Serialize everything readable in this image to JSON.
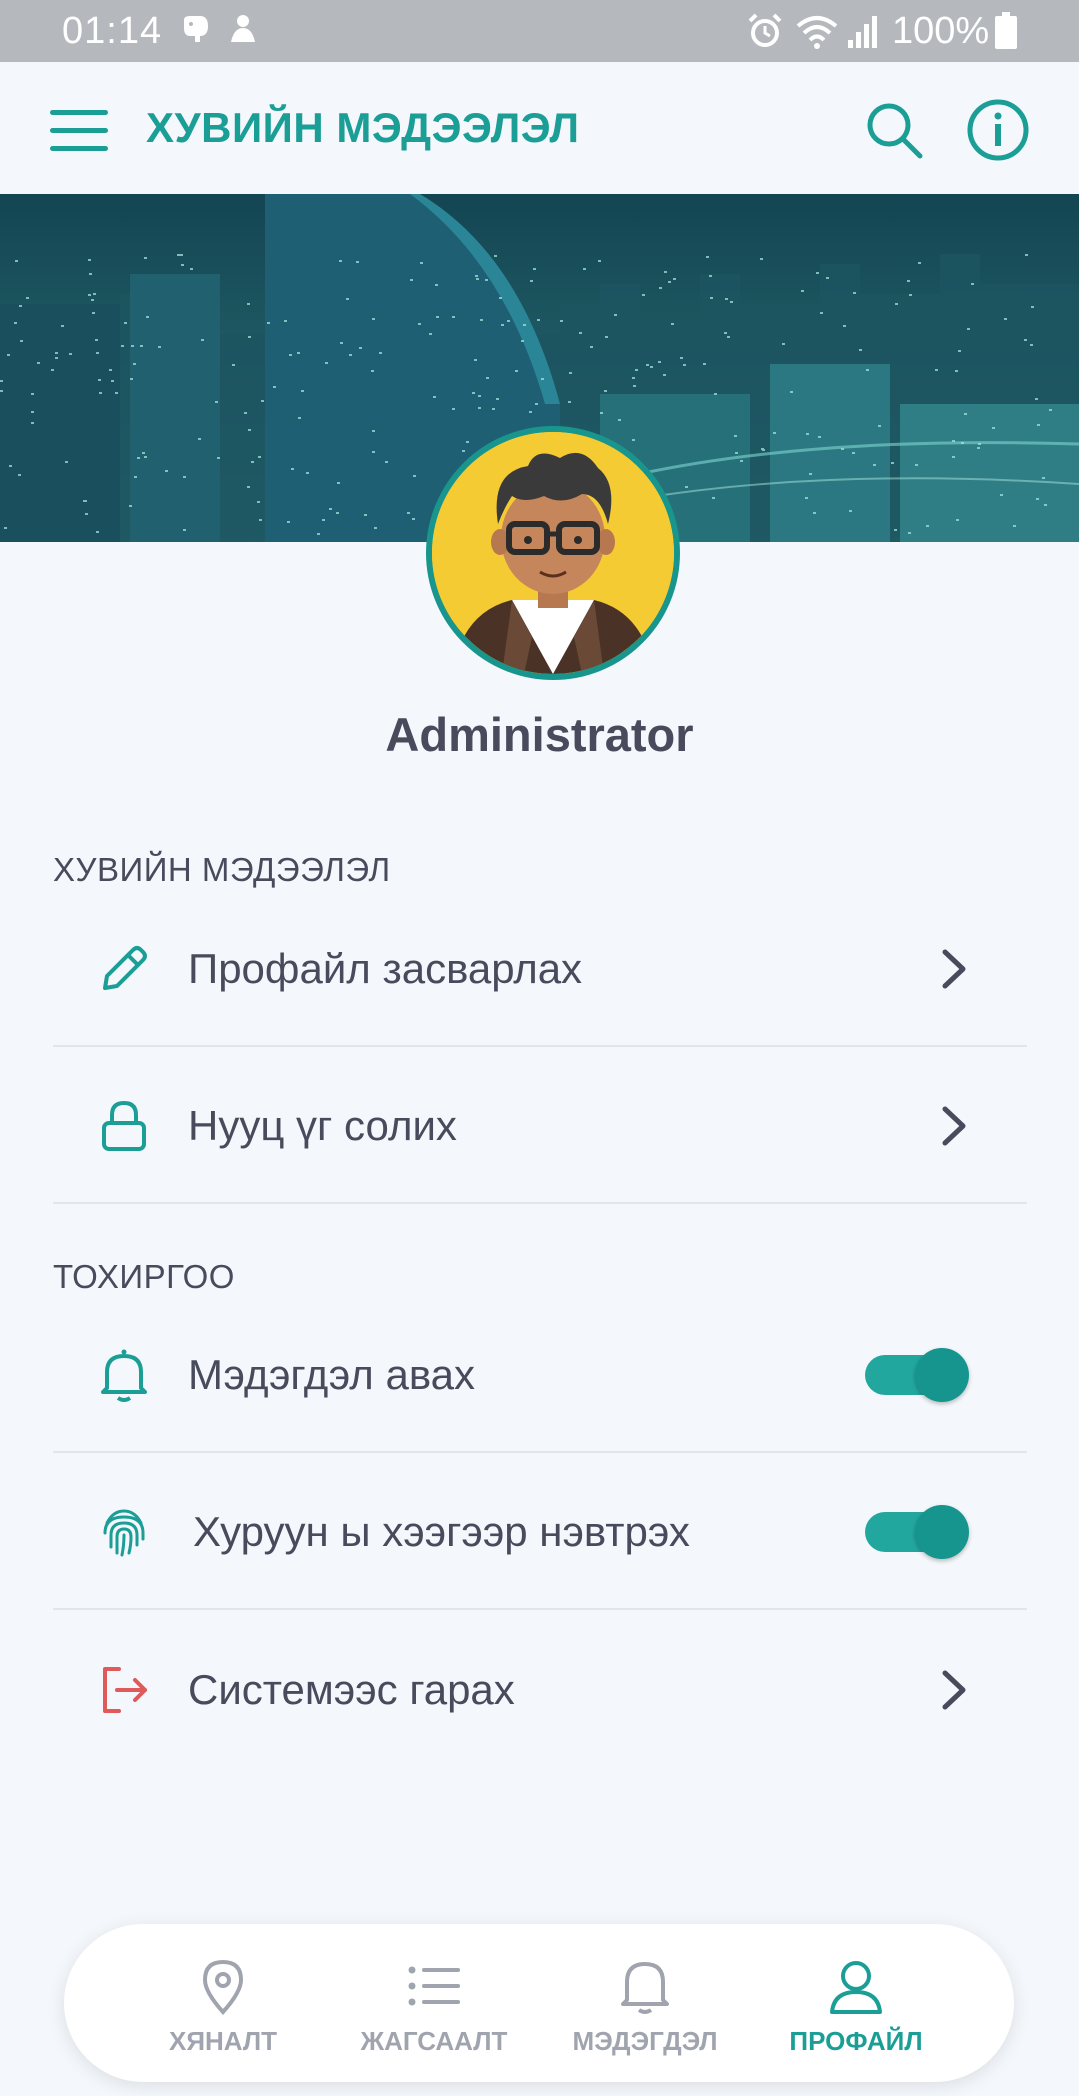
{
  "status_bar": {
    "time": "01:14",
    "battery": "100%",
    "icons": [
      "elephant-icon",
      "person-icon",
      "alarm-icon",
      "wifi-icon",
      "signal-icon",
      "battery-icon"
    ]
  },
  "app_bar": {
    "title": "ХУВИЙН МЭДЭЭЛЭЛ",
    "icons": [
      "menu-icon",
      "search-icon",
      "info-icon"
    ]
  },
  "profile": {
    "name": "Administrator"
  },
  "sections": {
    "personal": {
      "title": "ХУВИЙН МЭДЭЭЛЭЛ",
      "items": [
        {
          "label": "Профайл засварлах",
          "icon": "pencil-icon"
        },
        {
          "label": "Нууц үг солих",
          "icon": "lock-icon"
        }
      ]
    },
    "settings": {
      "title": "ТОХИРГОО",
      "items": [
        {
          "label": "Мэдэгдэл авах",
          "icon": "bell-icon",
          "toggle_on": true
        },
        {
          "label": "Хуруун ы хээгээр нэвтрэх",
          "icon": "fingerprint-icon",
          "toggle_on": true
        },
        {
          "label": "Системээс гарах",
          "icon": "logout-icon"
        }
      ]
    }
  },
  "bottom_nav": [
    {
      "label": "ХЯНАЛТ",
      "icon": "map-pin-icon",
      "active": false
    },
    {
      "label": "ЖАГСААЛТ",
      "icon": "list-icon",
      "active": false
    },
    {
      "label": "МЭДЭГДЭЛ",
      "icon": "bell-icon",
      "active": false
    },
    {
      "label": "ПРОФАЙЛ",
      "icon": "user-icon",
      "active": true
    }
  ],
  "colors": {
    "accent": "#1a9e96",
    "text": "#474b5c",
    "background": "#f4f7fb",
    "logout": "#e05a5a",
    "inactive_nav": "#a0a4ae"
  }
}
